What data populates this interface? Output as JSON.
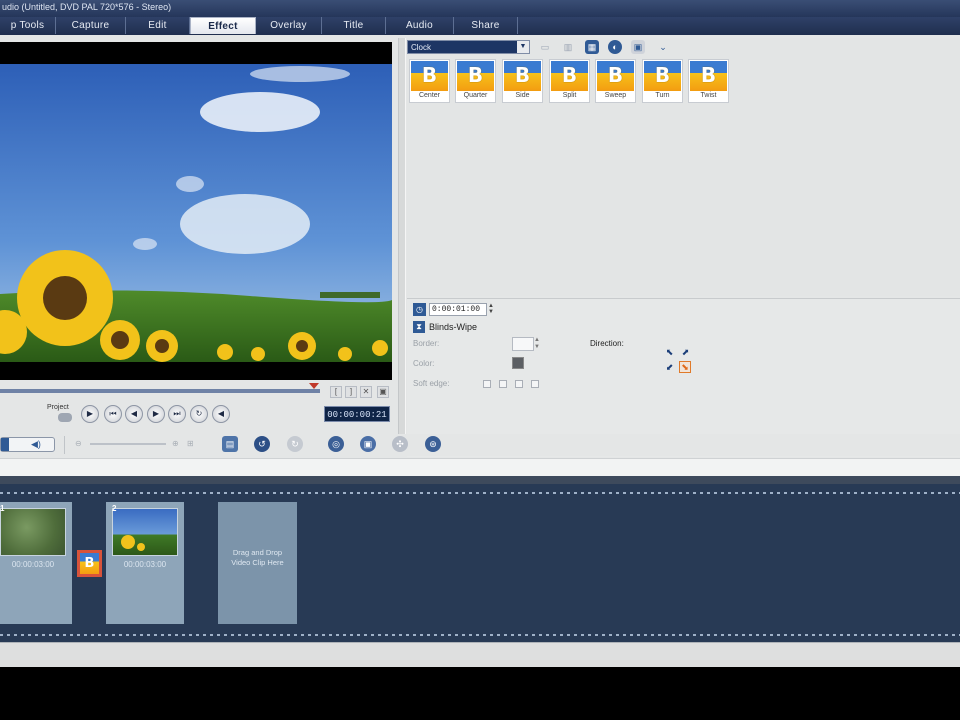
{
  "window": {
    "title": "udio (Untitled, DVD PAL 720*576 - Stereo)"
  },
  "tabs": [
    {
      "label": "p  Tools"
    },
    {
      "label": "Capture"
    },
    {
      "label": "Edit"
    },
    {
      "label": "Effect",
      "active": true
    },
    {
      "label": "Overlay"
    },
    {
      "label": "Title"
    },
    {
      "label": "Audio"
    },
    {
      "label": "Share"
    }
  ],
  "preview": {
    "project_label": "Project",
    "timecode": "00:00:00:21"
  },
  "gallery": {
    "folder_select": "Clock",
    "transitions": [
      {
        "label": "Center"
      },
      {
        "label": "Quarter"
      },
      {
        "label": "Side"
      },
      {
        "label": "Split"
      },
      {
        "label": "Sweep"
      },
      {
        "label": "Turn"
      },
      {
        "label": "Twist"
      }
    ]
  },
  "options": {
    "duration": "0:00:01:00",
    "effect_name": "Blinds-Wipe",
    "border_label": "Border:",
    "color_label": "Color:",
    "soft_edge_label": "Soft edge:",
    "direction_label": "Direction:",
    "border_value": ""
  },
  "storyboard": {
    "clips": [
      {
        "number": "1",
        "duration": "00:00:03:00"
      },
      {
        "number": "2",
        "duration": "00:00:03:00"
      }
    ],
    "drop_placeholder": "Drag and Drop Video Clip Here"
  },
  "colors": {
    "accent": "#1d3564",
    "storyboard": "#283a55",
    "transition_border": "#d8533b"
  }
}
